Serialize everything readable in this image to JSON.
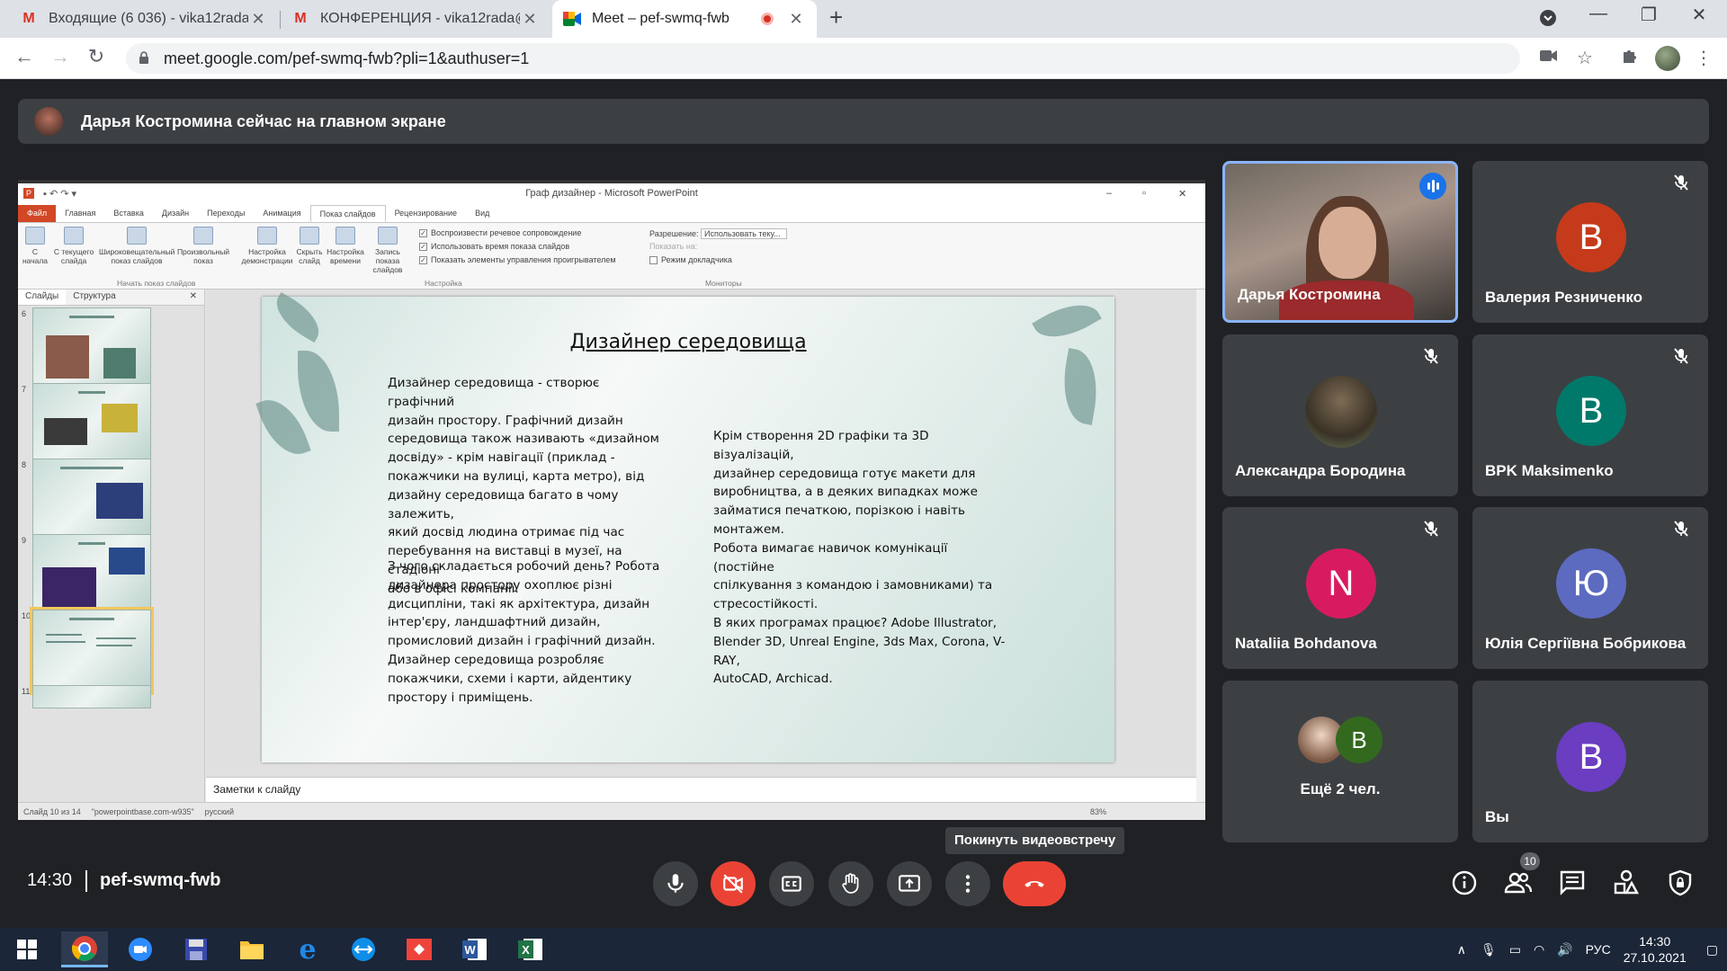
{
  "browser": {
    "tabs": [
      {
        "title": "Входящие (6 036) - vika12rada@",
        "icon": "gmail-icon",
        "active": false
      },
      {
        "title": "КОНФЕРЕНЦИЯ - vika12rada@g",
        "icon": "gmail-icon",
        "active": false
      },
      {
        "title": "Meet – pef-swmq-fwb",
        "icon": "meet-icon",
        "active": true
      }
    ],
    "url": "meet.google.com/pef-swmq-fwb?pli=1&authuser=1"
  },
  "meet": {
    "banner": "Дарья Костромина сейчас на главном экране",
    "clock": "14:30",
    "meeting_code": "pef-swmq-fwb",
    "leave_tooltip": "Покинуть видеовстречу",
    "participant_count": "10",
    "tiles": [
      {
        "name": "Дарья Костромина",
        "type": "video",
        "speaking": true
      },
      {
        "name": "Валерия Резниченко",
        "initial": "В",
        "color": "#c53a1a",
        "muted": true
      },
      {
        "name": "Александра Бородина",
        "type": "photo",
        "muted": true
      },
      {
        "name": "BPK Maksimenko",
        "initial": "B",
        "color": "#00796b",
        "muted": true
      },
      {
        "name": "Nataliia Bohdanova",
        "initial": "N",
        "color": "#d81b60",
        "muted": true
      },
      {
        "name": "Юлія Сергіївна Бобрикова",
        "initial": "Ю",
        "color": "#5c6bc0",
        "muted": true
      },
      {
        "name": "Ещё 2 чел.",
        "initial": "В",
        "color": "#33691e"
      },
      {
        "name": "Вы",
        "initial": "В",
        "color": "#6a3dc1"
      }
    ]
  },
  "ppt": {
    "window_title": "Граф дизайнер - Microsoft PowerPoint",
    "menu": [
      "Файл",
      "Главная",
      "Вставка",
      "Дизайн",
      "Переходы",
      "Анимация",
      "Показ слайдов",
      "Рецензирование",
      "Вид"
    ],
    "ribbon_buttons": [
      "С начала",
      "С текущего слайда",
      "Широковещательный показ слайдов",
      "Произвольный показ",
      "Настройка демонстрации",
      "Скрыть слайд",
      "Настройка времени",
      "Запись показа слайдов"
    ],
    "checks": [
      "Воспроизвести речевое сопровождение",
      "Использовать время показа слайдов",
      "Показать элементы управления проигрывателем"
    ],
    "resolution_label": "Разрешение:",
    "resolution_value": "Использовать теку...",
    "show_on_label": "Показать на:",
    "presenter_mode": "Режим докладчика",
    "groups": [
      "Начать показ слайдов",
      "Настройка",
      "Мониторы"
    ],
    "panel_tabs": [
      "Слайды",
      "Структура"
    ],
    "slide_numbers": [
      "6",
      "7",
      "8",
      "9",
      "10",
      "11"
    ],
    "notes": "Заметки к слайду",
    "status_slide": "Слайд 10 из 14",
    "status_theme": "\"powerpointbase.com-w935\"",
    "status_lang": "русский",
    "zoom": "83%"
  },
  "slide": {
    "title": "Дизайнер середовища",
    "left_p1": [
      "Дизайнер середовища - створює графічний",
      "дизайн простору. Графічний дизайн",
      "середовища також називають «дизайном",
      "досвіду» - крім навігації (приклад -",
      "покажчики на вулиці, карта метро), від",
      "дизайну середовища багато в чому залежить,",
      "який досвід людина отримає під час",
      "перебування на виставці в музеї, на стадіоні",
      "або в офісі компанії."
    ],
    "left_p2": [
      "З чого складається робочий день? Робота",
      "дизайнера простору охоплює різні",
      "дисципліни, такі як архітектура, дизайн",
      "інтер'єру, ландшафтний дизайн,",
      "промисловий дизайн і графічний дизайн.",
      "Дизайнер середовища розробляє",
      "покажчики, схеми і карти, айдентику",
      "простору і приміщень."
    ],
    "right_p": [
      "Крім створення 2D графіки та 3D візуалізацій,",
      "дизайнер середовища готує макети для",
      "виробництва, а в деяких випадках може",
      "займатися печаткою, порізкою і навіть монтажем.",
      "Робота вимагає навичок комунікації (постійне",
      "спілкування з командою і замовниками) та",
      "стресостійкості.",
      "В яких програмах працює? Adobe Illustrator,",
      "Blender 3D, Unreal Engine, 3ds Max, Corona, V-RAY,",
      "AutoCAD, Archicad."
    ]
  },
  "taskbar": {
    "apps": [
      "start-icon",
      "chrome-icon",
      "zoom-icon",
      "save-icon",
      "explorer-icon",
      "edge-icon",
      "teamviewer-icon",
      "anydesk-icon",
      "word-icon",
      "excel-icon"
    ],
    "lang": "РУС",
    "time": "14:30",
    "date": "27.10.2021"
  }
}
